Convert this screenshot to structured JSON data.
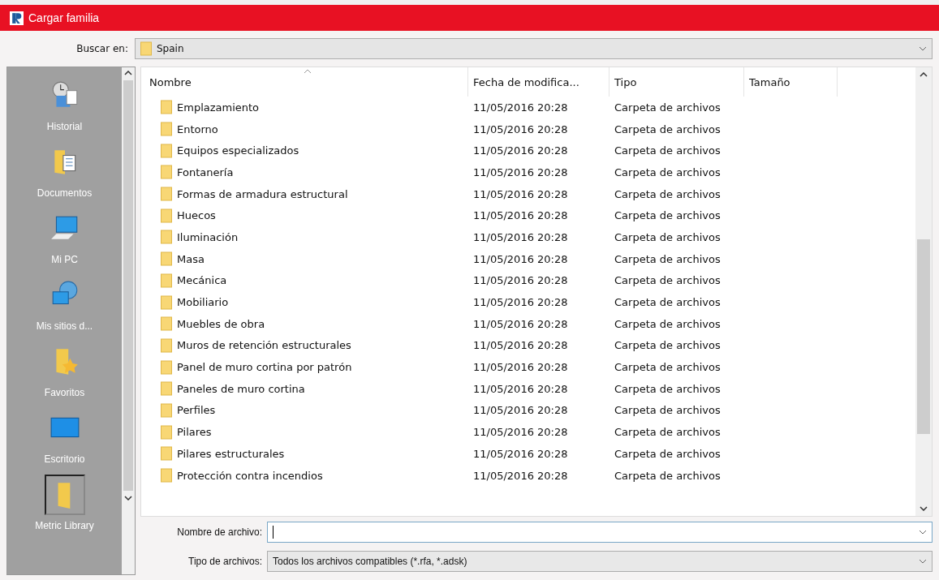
{
  "window": {
    "title": "Cargar familia"
  },
  "look_in": {
    "label": "Buscar en:",
    "value": "Spain"
  },
  "sidebar": {
    "items": [
      {
        "label": "Historial",
        "kind": "history",
        "selected": false
      },
      {
        "label": "Documentos",
        "kind": "documents",
        "selected": false
      },
      {
        "label": "Mi PC",
        "kind": "computer",
        "selected": false
      },
      {
        "label": "Mis sitios d...",
        "kind": "network",
        "selected": false
      },
      {
        "label": "Favoritos",
        "kind": "favorites",
        "selected": false
      },
      {
        "label": "Escritorio",
        "kind": "desktop",
        "selected": false
      },
      {
        "label": "Metric Library",
        "kind": "folder",
        "selected": true
      }
    ]
  },
  "table": {
    "columns": [
      "Nombre",
      "Fecha de modifica...",
      "Tipo",
      "Tamaño"
    ],
    "rows": [
      [
        "Emplazamiento",
        "11/05/2016 20:28",
        "Carpeta de archivos"
      ],
      [
        "Entorno",
        "11/05/2016 20:28",
        "Carpeta de archivos"
      ],
      [
        "Equipos especializados",
        "11/05/2016 20:28",
        "Carpeta de archivos"
      ],
      [
        "Fontanería",
        "11/05/2016 20:28",
        "Carpeta de archivos"
      ],
      [
        "Formas de armadura estructural",
        "11/05/2016 20:28",
        "Carpeta de archivos"
      ],
      [
        "Huecos",
        "11/05/2016 20:28",
        "Carpeta de archivos"
      ],
      [
        "Iluminación",
        "11/05/2016 20:28",
        "Carpeta de archivos"
      ],
      [
        "Masa",
        "11/05/2016 20:28",
        "Carpeta de archivos"
      ],
      [
        "Mecánica",
        "11/05/2016 20:28",
        "Carpeta de archivos"
      ],
      [
        "Mobiliario",
        "11/05/2016 20:28",
        "Carpeta de archivos"
      ],
      [
        "Muebles de obra",
        "11/05/2016 20:28",
        "Carpeta de archivos"
      ],
      [
        "Muros de retención estructurales",
        "11/05/2016 20:28",
        "Carpeta de archivos"
      ],
      [
        "Panel de muro cortina por patrón",
        "11/05/2016 20:28",
        "Carpeta de archivos"
      ],
      [
        "Paneles de muro cortina",
        "11/05/2016 20:28",
        "Carpeta de archivos"
      ],
      [
        "Perfiles",
        "11/05/2016 20:28",
        "Carpeta de archivos"
      ],
      [
        "Pilares",
        "11/05/2016 20:28",
        "Carpeta de archivos"
      ],
      [
        "Pilares estructurales",
        "11/05/2016 20:28",
        "Carpeta de archivos"
      ],
      [
        "Protección contra incendios",
        "11/05/2016 20:28",
        "Carpeta de archivos"
      ]
    ]
  },
  "file_name": {
    "label": "Nombre de archivo:"
  },
  "file_type": {
    "label": "Tipo de archivos:",
    "value": "Todos los archivos compatibles  (*.rfa, *.adsk)"
  }
}
